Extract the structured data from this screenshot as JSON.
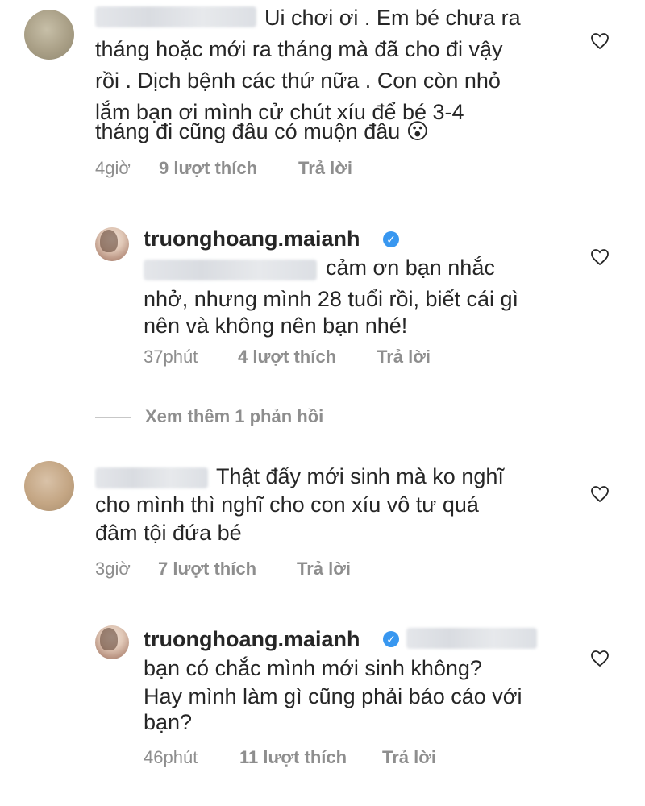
{
  "comments": [
    {
      "text_lines": [
        "Ui chơi ơi . Em bé chưa ra",
        "tháng hoặc mới ra tháng mà đã cho đi vậy",
        "rồi . Dịch bệnh các thứ nữa . Con còn nhỏ",
        "lắm bạn ơi mình cử chút xíu để bé 3-4",
        "tháng đi cũng đâu có muộn đâu 😮"
      ],
      "time": "4giờ",
      "likes": "9 lượt thích",
      "reply": "Trả lời"
    },
    {
      "username": "truonghoang.maianh",
      "text_lines": [
        "cảm ơn bạn nhắc",
        "nhở, nhưng mình 28 tuổi rồi, biết cái gì",
        "nên và không nên bạn nhé!"
      ],
      "time": "37phút",
      "likes": "4 lượt thích",
      "reply": "Trả lời"
    },
    {
      "text_lines": [
        "Thật đấy mới sinh mà ko nghĩ",
        "cho mình thì nghĩ cho con xíu vô tư quá",
        "đâm tội đứa bé"
      ],
      "time": "3giờ",
      "likes": "7 lượt thích",
      "reply": "Trả lời"
    },
    {
      "username": "truonghoang.maianh",
      "text_lines": [
        "bạn có chắc mình mới sinh không?",
        "Hay mình làm gì cũng phải báo cáo với",
        "bạn?"
      ],
      "time": "46phút",
      "likes": "11 lượt thích",
      "reply": "Trả lời"
    }
  ],
  "view_more_replies": "Xem thêm 1 phản hồi",
  "colors": {
    "text": "#262626",
    "meta": "#8e8e8e",
    "verified": "#3897f0"
  }
}
